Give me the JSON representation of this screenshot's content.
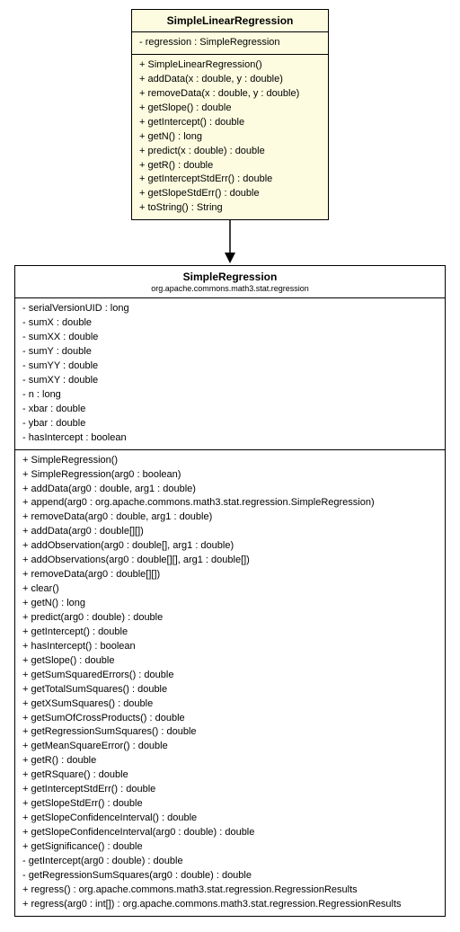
{
  "class1": {
    "name": "SimpleLinearRegression",
    "attributes": [
      "- regression : SimpleRegression"
    ],
    "methods": [
      "+ SimpleLinearRegression()",
      "+ addData(x : double, y : double)",
      "+ removeData(x : double, y : double)",
      "+ getSlope() : double",
      "+ getIntercept() : double",
      "+ getN() : long",
      "+ predict(x : double) : double",
      "+ getR() : double",
      "+ getInterceptStdErr() : double",
      "+ getSlopeStdErr() : double",
      "+ toString() : String"
    ]
  },
  "class2": {
    "name": "SimpleRegression",
    "package": "org.apache.commons.math3.stat.regression",
    "attributes": [
      "- serialVersionUID : long",
      "- sumX : double",
      "- sumXX : double",
      "- sumY : double",
      "- sumYY : double",
      "- sumXY : double",
      "- n : long",
      "- xbar : double",
      "- ybar : double",
      "- hasIntercept : boolean"
    ],
    "methods": [
      "+ SimpleRegression()",
      "+ SimpleRegression(arg0 : boolean)",
      "+ addData(arg0 : double, arg1 : double)",
      "+ append(arg0 : org.apache.commons.math3.stat.regression.SimpleRegression)",
      "+ removeData(arg0 : double, arg1 : double)",
      "+ addData(arg0 : double[][])",
      "+ addObservation(arg0 : double[], arg1 : double)",
      "+ addObservations(arg0 : double[][], arg1 : double[])",
      "+ removeData(arg0 : double[][])",
      "+ clear()",
      "+ getN() : long",
      "+ predict(arg0 : double) : double",
      "+ getIntercept() : double",
      "+ hasIntercept() : boolean",
      "+ getSlope() : double",
      "+ getSumSquaredErrors() : double",
      "+ getTotalSumSquares() : double",
      "+ getXSumSquares() : double",
      "+ getSumOfCrossProducts() : double",
      "+ getRegressionSumSquares() : double",
      "+ getMeanSquareError() : double",
      "+ getR() : double",
      "+ getRSquare() : double",
      "+ getInterceptStdErr() : double",
      "+ getSlopeStdErr() : double",
      "+ getSlopeConfidenceInterval() : double",
      "+ getSlopeConfidenceInterval(arg0 : double) : double",
      "+ getSignificance() : double",
      "- getIntercept(arg0 : double) : double",
      "- getRegressionSumSquares(arg0 : double) : double",
      "+ regress() : org.apache.commons.math3.stat.regression.RegressionResults",
      "+ regress(arg0 : int[]) : org.apache.commons.math3.stat.regression.RegressionResults"
    ]
  }
}
